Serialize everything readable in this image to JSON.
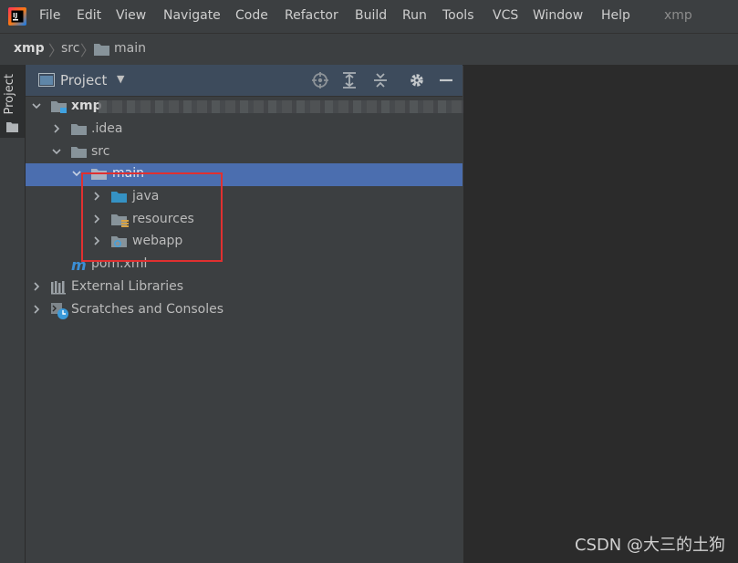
{
  "menubar": {
    "items": [
      "File",
      "Edit",
      "View",
      "Navigate",
      "Code",
      "Refactor",
      "Build",
      "Run",
      "Tools",
      "VCS",
      "Window",
      "Help"
    ],
    "project_name": "xmp"
  },
  "breadcrumb": [
    "xmp",
    "src",
    "main"
  ],
  "stripe": {
    "label": "Project"
  },
  "panel": {
    "title": "Project"
  },
  "tree": [
    {
      "label": "xmp",
      "icon": "module-folder-icon"
    },
    {
      "label": ".idea",
      "icon": "folder-icon"
    },
    {
      "label": "src",
      "icon": "folder-icon"
    },
    {
      "label": "main",
      "icon": "folder-icon"
    },
    {
      "label": "java",
      "icon": "source-folder-icon"
    },
    {
      "label": "resources",
      "icon": "resources-folder-icon"
    },
    {
      "label": "webapp",
      "icon": "web-folder-icon"
    },
    {
      "label": "pom.xml",
      "icon": "maven-icon"
    },
    {
      "label": "External Libraries",
      "icon": "libraries-icon"
    },
    {
      "label": "Scratches and Consoles",
      "icon": "scratches-icon"
    }
  ],
  "watermark": "CSDN @大三的土狗",
  "colors": {
    "background": "#3c3f41",
    "editor": "#2b2b2b",
    "selection": "#4b6eaf",
    "panel_header": "#3d4b5c",
    "highlight_box": "#e03030"
  }
}
